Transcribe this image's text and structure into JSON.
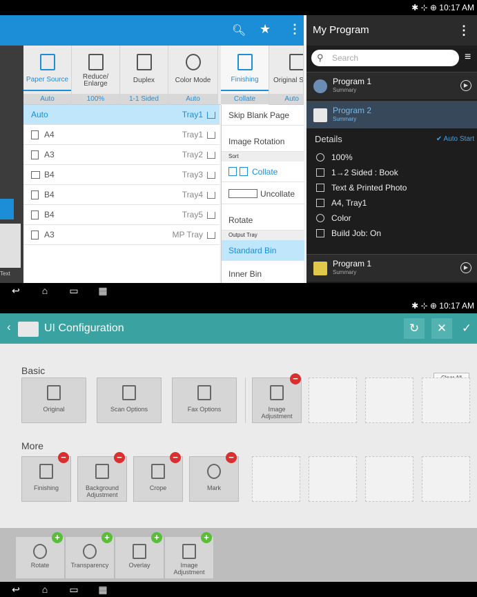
{
  "top": {
    "status_time": "✱ ⊹ ⊕ 10:17 AM",
    "tabs": [
      {
        "label": "Paper Source",
        "value": "Auto"
      },
      {
        "label": "Reduce/ Enlarge",
        "value": "100%"
      },
      {
        "label": "Duplex",
        "value": "1-1 Sided"
      },
      {
        "label": "Color Mode",
        "value": "Auto"
      },
      {
        "label": "Finishing",
        "value": "Collate"
      },
      {
        "label": "Original S",
        "value": "Auto"
      }
    ],
    "trays": [
      {
        "name": "Auto",
        "tray": "Tray1"
      },
      {
        "name": "A4",
        "tray": "Tray1"
      },
      {
        "name": "A3",
        "tray": "Tray2"
      },
      {
        "name": "B4",
        "tray": "Tray3"
      },
      {
        "name": "B4",
        "tray": "Tray4"
      },
      {
        "name": "B4",
        "tray": "Tray5"
      },
      {
        "name": "A3",
        "tray": "MP Tray"
      }
    ],
    "options": {
      "skip_blank": "Skip Blank Page",
      "image_rotation": "Image Rotation",
      "sort_header": "Sort",
      "collate": "Collate",
      "uncollate": "Uncollate",
      "rotate": "Rotate",
      "output_header": "Output Tray",
      "standard_bin": "Standard Bin",
      "inner_bin": "Inner Bin"
    },
    "left_text": "Text",
    "panel": {
      "title": "My Program",
      "search_placeholder": "Search",
      "program1": {
        "name": "Program 1",
        "sub": "Summary"
      },
      "program2": {
        "name": "Program 2",
        "sub": "Summary"
      },
      "details_label": "Details",
      "auto_start": "✔ Auto Start",
      "details": [
        "100%",
        "1→2 Sided : Book",
        "Text & Printed Photo",
        "A4, Tray1",
        "Color",
        "Build Job: On"
      ],
      "program3": {
        "name": "Program 1",
        "sub": "Summary"
      }
    }
  },
  "bottom": {
    "status_time": "✱ ⊹ ⊕ 10:17 AM",
    "title": "UI Configuration",
    "clear_all": "Clear All",
    "basic_label": "Basic",
    "basic": [
      "Original",
      "Scan Options",
      "Fax Options",
      "Image Adjustment"
    ],
    "more_label": "More",
    "more": [
      "Finishing",
      "Background Adjustment",
      "Crope",
      "Mark"
    ],
    "available": [
      "Rotate",
      "Transparency",
      "Overlay",
      "Image Adjustment"
    ]
  },
  "colors": {
    "blue": "#1c8ed8",
    "teal": "#3aa2a0",
    "minus": "#d92f2f",
    "plus": "#5bbd3a"
  }
}
